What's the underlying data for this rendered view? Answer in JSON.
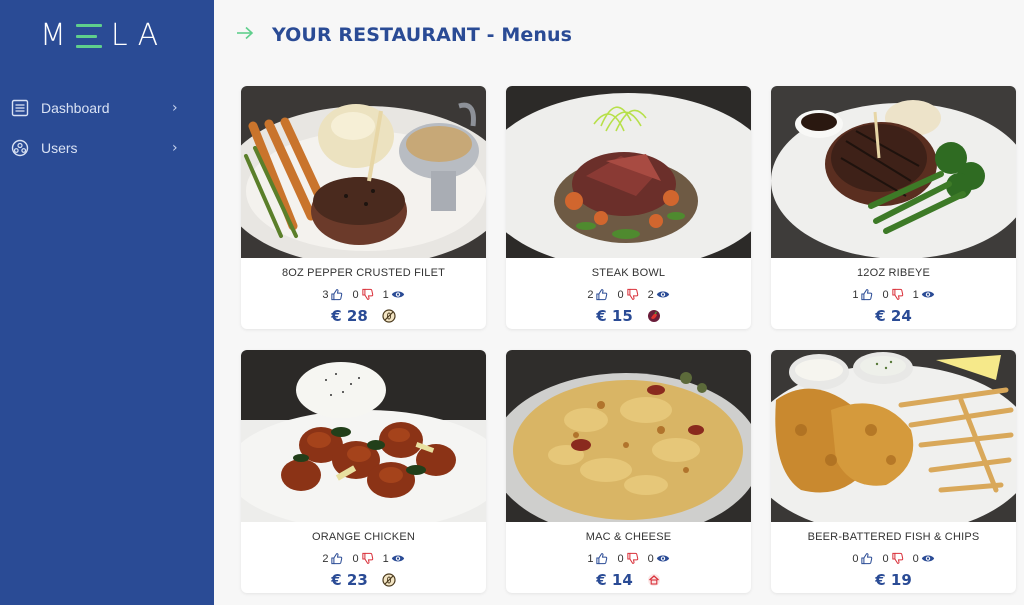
{
  "app": {
    "logo_letters": [
      "M",
      "L",
      "A"
    ],
    "accent_color": "#5fcf8c",
    "sidebar_color": "#2a4b95"
  },
  "sidebar": {
    "items": [
      {
        "label": "Dashboard",
        "icon": "list-icon"
      },
      {
        "label": "Users",
        "icon": "users-icon"
      }
    ]
  },
  "header": {
    "title": "YOUR RESTAURANT - Menus",
    "back_icon": "arrow-right-icon"
  },
  "menus": [
    {
      "name": "8OZ PEPPER CRUSTED FILET",
      "likes": "3",
      "dislikes": "0",
      "views": "1",
      "price": "€ 28",
      "badge": "no-gluten-icon",
      "image": "filet-steak-with-carrots"
    },
    {
      "name": "STEAK BOWL",
      "likes": "2",
      "dislikes": "0",
      "views": "2",
      "price": "€ 15",
      "badge": "chili-icon",
      "image": "steak-bowl"
    },
    {
      "name": "12OZ RIBEYE",
      "likes": "1",
      "dislikes": "0",
      "views": "1",
      "price": "€ 24",
      "badge": "",
      "image": "ribeye-with-broccoli"
    },
    {
      "name": "ORANGE CHICKEN",
      "likes": "2",
      "dislikes": "0",
      "views": "1",
      "price": "€ 23",
      "badge": "no-gluten-icon",
      "image": "orange-chicken-with-rice"
    },
    {
      "name": "MAC & CHEESE",
      "likes": "1",
      "dislikes": "0",
      "views": "0",
      "price": "€ 14",
      "badge": "house-special-icon",
      "image": "mac-and-cheese"
    },
    {
      "name": "BEER-BATTERED FISH & CHIPS",
      "likes": "0",
      "dislikes": "0",
      "views": "0",
      "price": "€ 19",
      "badge": "",
      "image": "fish-and-chips"
    }
  ]
}
